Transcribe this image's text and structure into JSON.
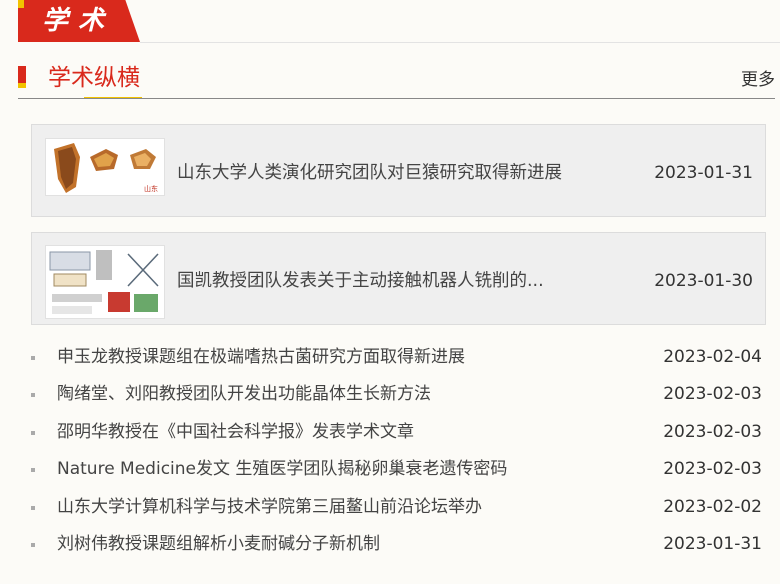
{
  "header": {
    "tab_label": "学术"
  },
  "section": {
    "title": "学术纵横",
    "more_label": "更多"
  },
  "featured": [
    {
      "title": "山东大学人类演化研究团队对巨猿研究取得新进展",
      "date": "2023-01-31"
    },
    {
      "title": "国凯教授团队发表关于主动接触机器人铣削的...",
      "date": "2023-01-30"
    }
  ],
  "news": [
    {
      "title": "申玉龙教授课题组在极端嗜热古菌研究方面取得新进展",
      "date": "2023-02-04"
    },
    {
      "title": "陶绪堂、刘阳教授团队开发出功能晶体生长新方法",
      "date": "2023-02-03"
    },
    {
      "title": "邵明华教授在《中国社会科学报》发表学术文章",
      "date": "2023-02-03"
    },
    {
      "title": "Nature Medicine发文 生殖医学团队揭秘卵巢衰老遗传密码",
      "date": "2023-02-03"
    },
    {
      "title": "山东大学计算机科学与技术学院第三届鳌山前沿论坛举办",
      "date": "2023-02-02"
    },
    {
      "title": "刘树伟教授课题组解析小麦耐碱分子新机制",
      "date": "2023-01-31"
    }
  ],
  "colors": {
    "brand_red": "#d9291c",
    "accent_yellow": "#f2c200"
  }
}
